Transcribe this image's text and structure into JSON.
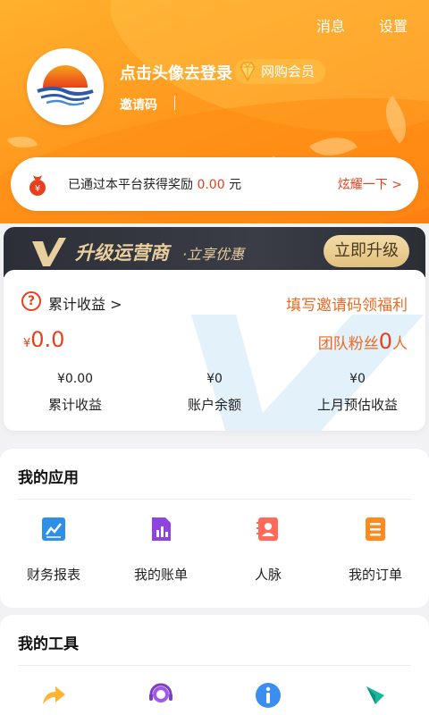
{
  "header": {
    "messages_label": "消息",
    "settings_label": "设置",
    "login_prompt": "点击头像去登录",
    "member_badge": "网购会员",
    "invite_code_label": "邀请码"
  },
  "reward": {
    "prefix": "已通过本平台获得奖励",
    "amount": "0.00",
    "unit": "元",
    "show_off": "炫耀一下 >"
  },
  "upgrade": {
    "title": "升级运营商",
    "subtitle": "·立享优惠",
    "button": "立即升级"
  },
  "earnings": {
    "title": "累计收益",
    "arrow": ">",
    "invite_welfare": "填写邀请码领福利",
    "currency": "¥",
    "amount": "0.0",
    "fans_prefix": "团队粉丝",
    "fans_count": "0",
    "fans_suffix": "人",
    "stats": [
      {
        "value": "¥0.00",
        "label": "累计收益"
      },
      {
        "value": "¥0",
        "label": "账户余额"
      },
      {
        "value": "¥0",
        "label": "上月预估收益"
      }
    ]
  },
  "apps": {
    "title": "我的应用",
    "items": [
      {
        "label": "财务报表",
        "icon": "chart-report-icon"
      },
      {
        "label": "我的账单",
        "icon": "bill-icon"
      },
      {
        "label": "人脉",
        "icon": "contacts-icon"
      },
      {
        "label": "我的订单",
        "icon": "order-list-icon"
      }
    ]
  },
  "tools": {
    "title": "我的工具",
    "items": [
      {
        "icon": "share-arrow-icon"
      },
      {
        "icon": "customer-service-icon"
      },
      {
        "icon": "info-icon"
      },
      {
        "icon": "compass-icon"
      }
    ]
  },
  "colors": {
    "header_orange": "#ff9a1f",
    "accent_red": "#e8401c",
    "accent_orange": "#ec6a22",
    "gold": "#e9cf9e"
  }
}
